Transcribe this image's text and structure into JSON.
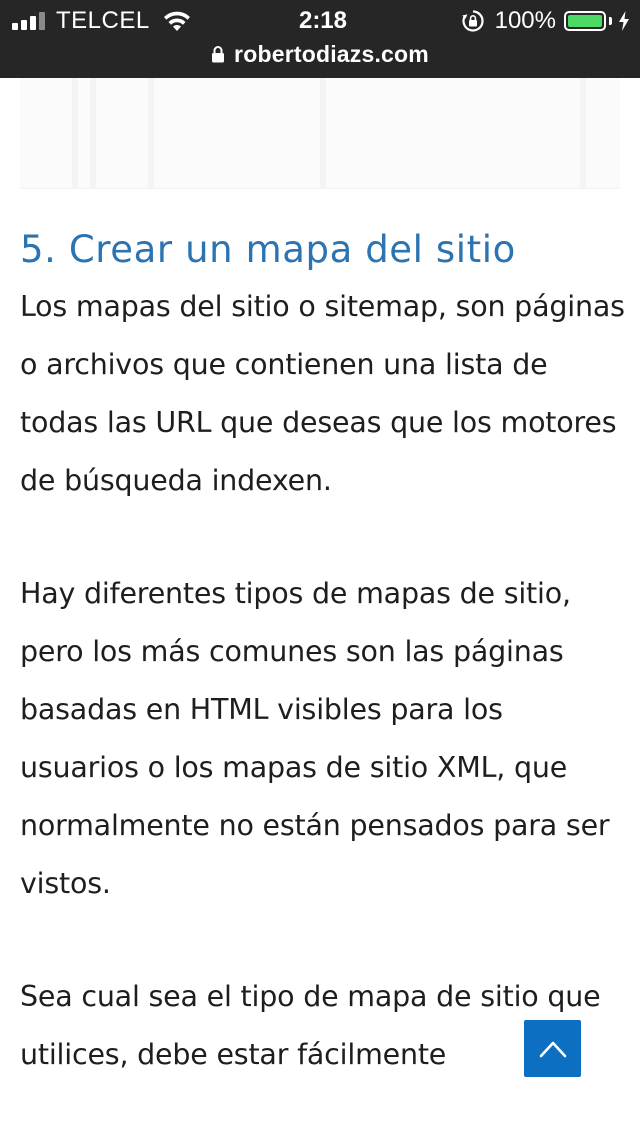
{
  "status_bar": {
    "carrier": "TELCEL",
    "time": "2:18",
    "battery_percent": "100%",
    "battery_level": 1.0,
    "icons": [
      "signal-icon",
      "wifi-icon",
      "orientation-lock-icon",
      "battery-icon",
      "charging-icon"
    ]
  },
  "browser": {
    "url": "robertodiazs.com",
    "icons": [
      "lock-icon"
    ]
  },
  "article": {
    "heading": "5. Crear un mapa del sitio",
    "paragraphs": [
      "Los mapas del sitio o sitemap, son páginas o archivos que contienen una lista de todas las URL que deseas que los motores de búsqueda indexen.",
      "Hay diferentes tipos de mapas de sitio, pero los más comunes son las páginas basadas en HTML visibles para los usuarios o los mapas de sitio XML, que normalmente no están pensados para ser vistos.",
      "Sea cual sea el tipo de mapa de sitio que utilices, debe estar fácilmente"
    ]
  },
  "scroll_top": {
    "icon": "chevron-up-icon",
    "color": "#0d6fc2"
  },
  "colors": {
    "heading": "#2b74b1",
    "status_bar_bg": "#262626",
    "battery_fill": "#4cd964"
  }
}
